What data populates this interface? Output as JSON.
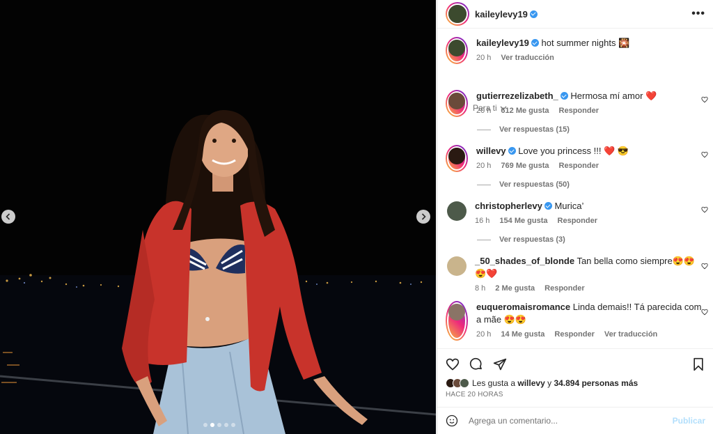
{
  "post": {
    "author": "kaileylevy19",
    "caption": "hot summer nights 🎇",
    "caption_time": "20 h",
    "caption_translate": "Ver traducción",
    "sort_label": "Para ti"
  },
  "comments": [
    {
      "user": "gutierrezelizabeth_",
      "verified": true,
      "text": "Hermosa mí amor ❤️",
      "time": "20 h",
      "likes": "612 Me gusta",
      "reply": "Responder",
      "replies": "Ver respuestas (15)"
    },
    {
      "user": "willevy",
      "verified": true,
      "text": "Love you princess !!! ❤️ 😎",
      "time": "20 h",
      "likes": "769 Me gusta",
      "reply": "Responder",
      "replies": "Ver respuestas (50)"
    },
    {
      "user": "christopherlevy",
      "verified": true,
      "text": "Murica’",
      "time": "16 h",
      "likes": "154 Me gusta",
      "reply": "Responder",
      "replies": "Ver respuestas (3)"
    },
    {
      "user": "_50_shades_of_blonde",
      "verified": false,
      "text": "Tan bella como siempre😍😍😍❤️",
      "time": "8 h",
      "likes": "2 Me gusta",
      "reply": "Responder"
    },
    {
      "user": "euqueromaisromance",
      "verified": false,
      "text": "Linda demais!! Tá parecida com a mãe 😍😍",
      "time": "20 h",
      "likes": "14 Me gusta",
      "reply": "Responder",
      "translate": "Ver traducción"
    }
  ],
  "likes": {
    "prefix": "Les gusta a",
    "user": "willevy",
    "suffix": "y",
    "count_text": "34.894 personas más"
  },
  "timestamp": "HACE 20 HORAS",
  "comment_input": {
    "placeholder": "Agrega un comentario...",
    "publish": "Publicar"
  },
  "carousel": {
    "total": 5,
    "active": 1
  },
  "colors": {
    "accent": "#3897f0",
    "heart": "#ed4956",
    "cardigan": "#c8332b"
  }
}
